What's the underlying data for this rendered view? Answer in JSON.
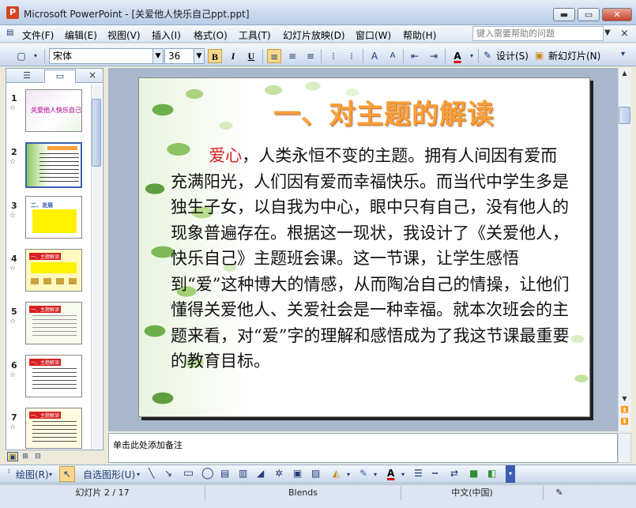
{
  "window": {
    "app_icon": "P",
    "title": "Microsoft PowerPoint - [关爱他人快乐自己ppt.ppt]",
    "min_label": "▬",
    "max_label": "▭",
    "close_label": "✕"
  },
  "menu": {
    "items": [
      "文件(F)",
      "编辑(E)",
      "视图(V)",
      "插入(I)",
      "格式(O)",
      "工具(T)",
      "幻灯片放映(D)",
      "窗口(W)",
      "帮助(H)"
    ],
    "help_placeholder": "键入需要帮助的问题",
    "doc_close": "×"
  },
  "toolbar": {
    "font_name": "宋体",
    "font_size": "36",
    "bold": "B",
    "italic": "I",
    "underline": "U",
    "design_label": "设计(S)",
    "new_slide_label": "新幻灯片(N)"
  },
  "slides_pane": {
    "close": "×",
    "star": "☆",
    "slide_numbers": [
      "1",
      "2",
      "3",
      "4",
      "5",
      "6",
      "7"
    ],
    "thumb1_title": "关爱他人快乐自己",
    "thumb3_title": "二、发展",
    "thumb_heading": "一、主题解读"
  },
  "slide": {
    "title": "一、对主题的解读",
    "keyword": "爱心",
    "body": "，人类永恒不变的主题。拥有人间因有爱而充满阳光，人们因有爱而幸福快乐。而当代中学生多是独生子女，以自我为中心，眼中只有自己，没有他人的现象普遍存在。根据这一现状，我设计了《关爱他人，快乐自己》主题班会课。这一节课，让学生感悟到“爱”这种博大的情感，从而陶冶自己的情操，让他们懂得关爱他人、关爱社会是一种幸福。就本次班会的主题来看，对“爱”字的理解和感悟成为了我这节课最重要的教育目标。"
  },
  "notes": {
    "placeholder": "单击此处添加备注"
  },
  "drawing_toolbar": {
    "draw_label": "绘图(R)",
    "autoshape_label": "自选图形(U)"
  },
  "status": {
    "slide_info": "幻灯片 2 / 17",
    "design_name": "Blends",
    "language": "中文(中国)"
  },
  "colors": {
    "title_orange": "#F6A03A",
    "keyword_red": "#D62020",
    "leaf_green": "#6BAF4A"
  }
}
